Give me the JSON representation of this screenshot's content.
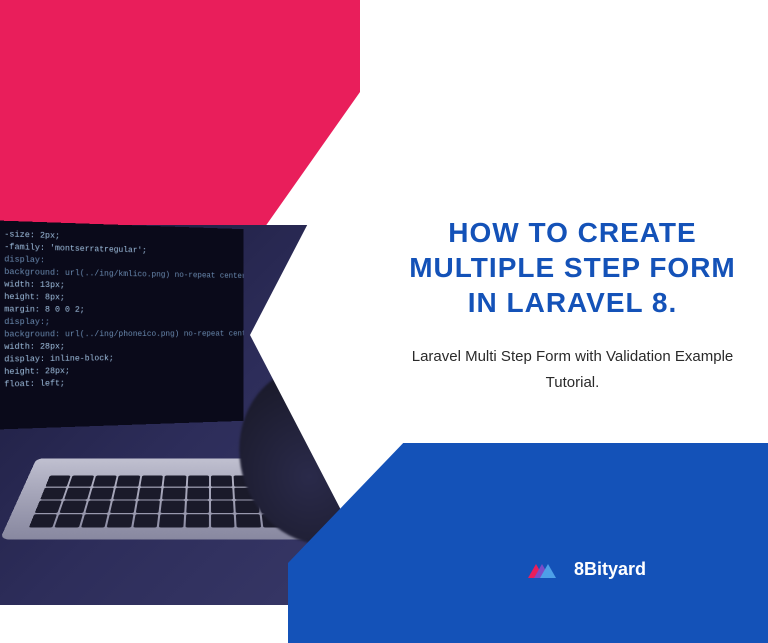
{
  "title": "HOW TO CREATE MULTIPLE STEP FORM IN LARAVEL 8.",
  "subtitle": "Laravel Multi Step Form with Validation Example Tutorial.",
  "brand": "8Bityard",
  "code_lines": [
    "-size: 2px;",
    "-family: 'montserratregular';",
    "display:",
    "background: url(../ing/kmlico.png) no-repeat center;",
    "width: 13px;",
    "height: 8px;",
    "margin: 8 0 0 2;",
    "display:;",
    "background: url(../ing/phoneico.png) no-repeat center;",
    "width: 28px;",
    "display: inline-block;",
    "height: 28px;",
    "float: left;"
  ]
}
